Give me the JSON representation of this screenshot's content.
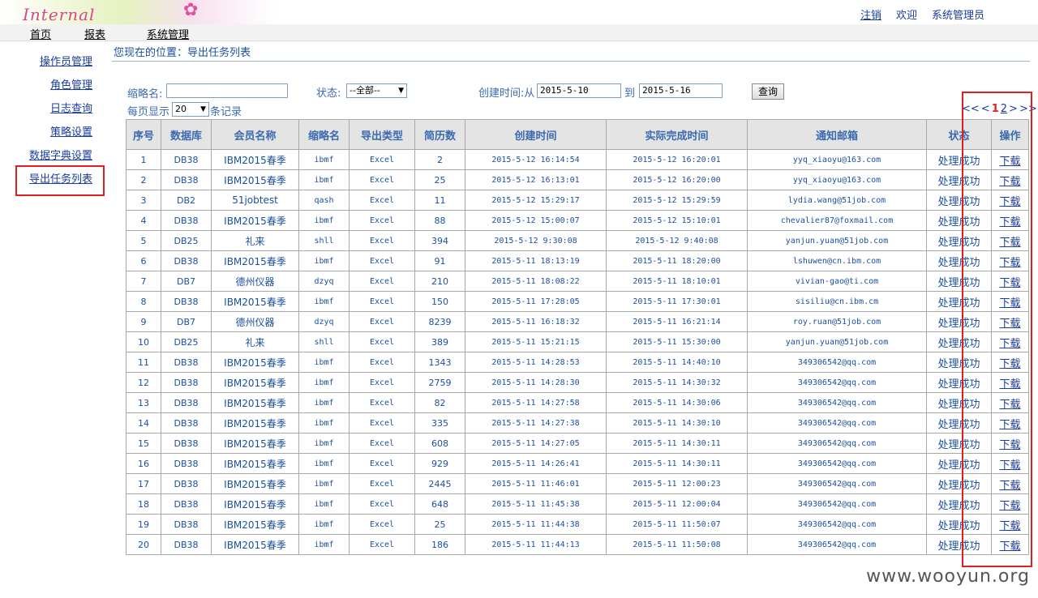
{
  "header": {
    "logo_text": "Internal",
    "links": {
      "logout": "注销",
      "welcome": "欢迎",
      "user": "系统管理员"
    }
  },
  "nav": [
    "首页",
    "报表",
    "系统管理"
  ],
  "sidebar": [
    "操作员管理",
    "角色管理",
    "日志查询",
    "策略设置",
    "数据字典设置",
    "导出任务列表"
  ],
  "breadcrumb": "您现在的位置：导出任务列表",
  "filters": {
    "abbr_label": "缩略名:",
    "abbr_value": "",
    "status_label": "状态:",
    "status_value": "--全部--",
    "created_from_label": "创建时间:从",
    "created_from": "2015-5-10",
    "to_label": "到",
    "created_to": "2015-5-16",
    "query_button": "查询",
    "per_page_label": "每页显示",
    "per_page_value": "20",
    "per_page_suffix": "条记录"
  },
  "pager": {
    "first": "<<",
    "prev": "<",
    "pages": [
      "1",
      "2"
    ],
    "current": "1",
    "next": ">",
    "last": ">>"
  },
  "table": {
    "columns": [
      "序号",
      "数据库",
      "会员名称",
      "缩略名",
      "导出类型",
      "简历数",
      "创建时间",
      "实际完成时间",
      "通知邮箱",
      "状态",
      "操作"
    ],
    "rows": [
      [
        "1",
        "DB38",
        "IBM2015春季",
        "ibmf",
        "Excel",
        "2",
        "2015-5-12 16:14:54",
        "2015-5-12 16:20:01",
        "yyq_xiaoyu@163.com",
        "处理成功",
        "下载"
      ],
      [
        "2",
        "DB38",
        "IBM2015春季",
        "ibmf",
        "Excel",
        "25",
        "2015-5-12 16:13:01",
        "2015-5-12 16:20:00",
        "yyq_xiaoyu@163.com",
        "处理成功",
        "下载"
      ],
      [
        "3",
        "DB2",
        "51jobtest",
        "qash",
        "Excel",
        "11",
        "2015-5-12 15:29:17",
        "2015-5-12 15:29:59",
        "lydia.wang@51job.com",
        "处理成功",
        "下载"
      ],
      [
        "4",
        "DB38",
        "IBM2015春季",
        "ibmf",
        "Excel",
        "88",
        "2015-5-12 15:00:07",
        "2015-5-12 15:10:01",
        "chevalier87@foxmail.com",
        "处理成功",
        "下载"
      ],
      [
        "5",
        "DB25",
        "礼来",
        "shll",
        "Excel",
        "394",
        "2015-5-12 9:30:08",
        "2015-5-12 9:40:08",
        "yanjun.yuan@51job.com",
        "处理成功",
        "下载"
      ],
      [
        "6",
        "DB38",
        "IBM2015春季",
        "ibmf",
        "Excel",
        "91",
        "2015-5-11 18:13:19",
        "2015-5-11 18:20:00",
        "lshuwen@cn.ibm.com",
        "处理成功",
        "下载"
      ],
      [
        "7",
        "DB7",
        "德州仪器",
        "dzyq",
        "Excel",
        "210",
        "2015-5-11 18:08:22",
        "2015-5-11 18:10:01",
        "vivian-gao@ti.com",
        "处理成功",
        "下载"
      ],
      [
        "8",
        "DB38",
        "IBM2015春季",
        "ibmf",
        "Excel",
        "150",
        "2015-5-11 17:28:05",
        "2015-5-11 17:30:01",
        "sisiliu@cn.ibm.cm",
        "处理成功",
        "下载"
      ],
      [
        "9",
        "DB7",
        "德州仪器",
        "dzyq",
        "Excel",
        "8239",
        "2015-5-11 16:18:32",
        "2015-5-11 16:21:14",
        "roy.ruan@51job.com",
        "处理成功",
        "下载"
      ],
      [
        "10",
        "DB25",
        "礼来",
        "shll",
        "Excel",
        "389",
        "2015-5-11 15:21:15",
        "2015-5-11 15:30:00",
        "yanjun.yuan@51job.com",
        "处理成功",
        "下载"
      ],
      [
        "11",
        "DB38",
        "IBM2015春季",
        "ibmf",
        "Excel",
        "1343",
        "2015-5-11 14:28:53",
        "2015-5-11 14:40:10",
        "349306542@qq.com",
        "处理成功",
        "下载"
      ],
      [
        "12",
        "DB38",
        "IBM2015春季",
        "ibmf",
        "Excel",
        "2759",
        "2015-5-11 14:28:30",
        "2015-5-11 14:30:32",
        "349306542@qq.com",
        "处理成功",
        "下载"
      ],
      [
        "13",
        "DB38",
        "IBM2015春季",
        "ibmf",
        "Excel",
        "82",
        "2015-5-11 14:27:58",
        "2015-5-11 14:30:06",
        "349306542@qq.com",
        "处理成功",
        "下载"
      ],
      [
        "14",
        "DB38",
        "IBM2015春季",
        "ibmf",
        "Excel",
        "335",
        "2015-5-11 14:27:38",
        "2015-5-11 14:30:10",
        "349306542@qq.com",
        "处理成功",
        "下载"
      ],
      [
        "15",
        "DB38",
        "IBM2015春季",
        "ibmf",
        "Excel",
        "608",
        "2015-5-11 14:27:05",
        "2015-5-11 14:30:11",
        "349306542@qq.com",
        "处理成功",
        "下载"
      ],
      [
        "16",
        "DB38",
        "IBM2015春季",
        "ibmf",
        "Excel",
        "929",
        "2015-5-11 14:26:41",
        "2015-5-11 14:30:11",
        "349306542@qq.com",
        "处理成功",
        "下载"
      ],
      [
        "17",
        "DB38",
        "IBM2015春季",
        "ibmf",
        "Excel",
        "2445",
        "2015-5-11 11:46:01",
        "2015-5-11 12:00:23",
        "349306542@qq.com",
        "处理成功",
        "下载"
      ],
      [
        "18",
        "DB38",
        "IBM2015春季",
        "ibmf",
        "Excel",
        "648",
        "2015-5-11 11:45:38",
        "2015-5-11 12:00:04",
        "349306542@qq.com",
        "处理成功",
        "下载"
      ],
      [
        "19",
        "DB38",
        "IBM2015春季",
        "ibmf",
        "Excel",
        "25",
        "2015-5-11 11:44:38",
        "2015-5-11 11:50:07",
        "349306542@qq.com",
        "处理成功",
        "下载"
      ],
      [
        "20",
        "DB38",
        "IBM2015春季",
        "ibmf",
        "Excel",
        "186",
        "2015-5-11 11:44:13",
        "2015-5-11 11:50:08",
        "349306542@qq.com",
        "处理成功",
        "下载"
      ]
    ]
  },
  "watermark": "www.wooyun.org"
}
